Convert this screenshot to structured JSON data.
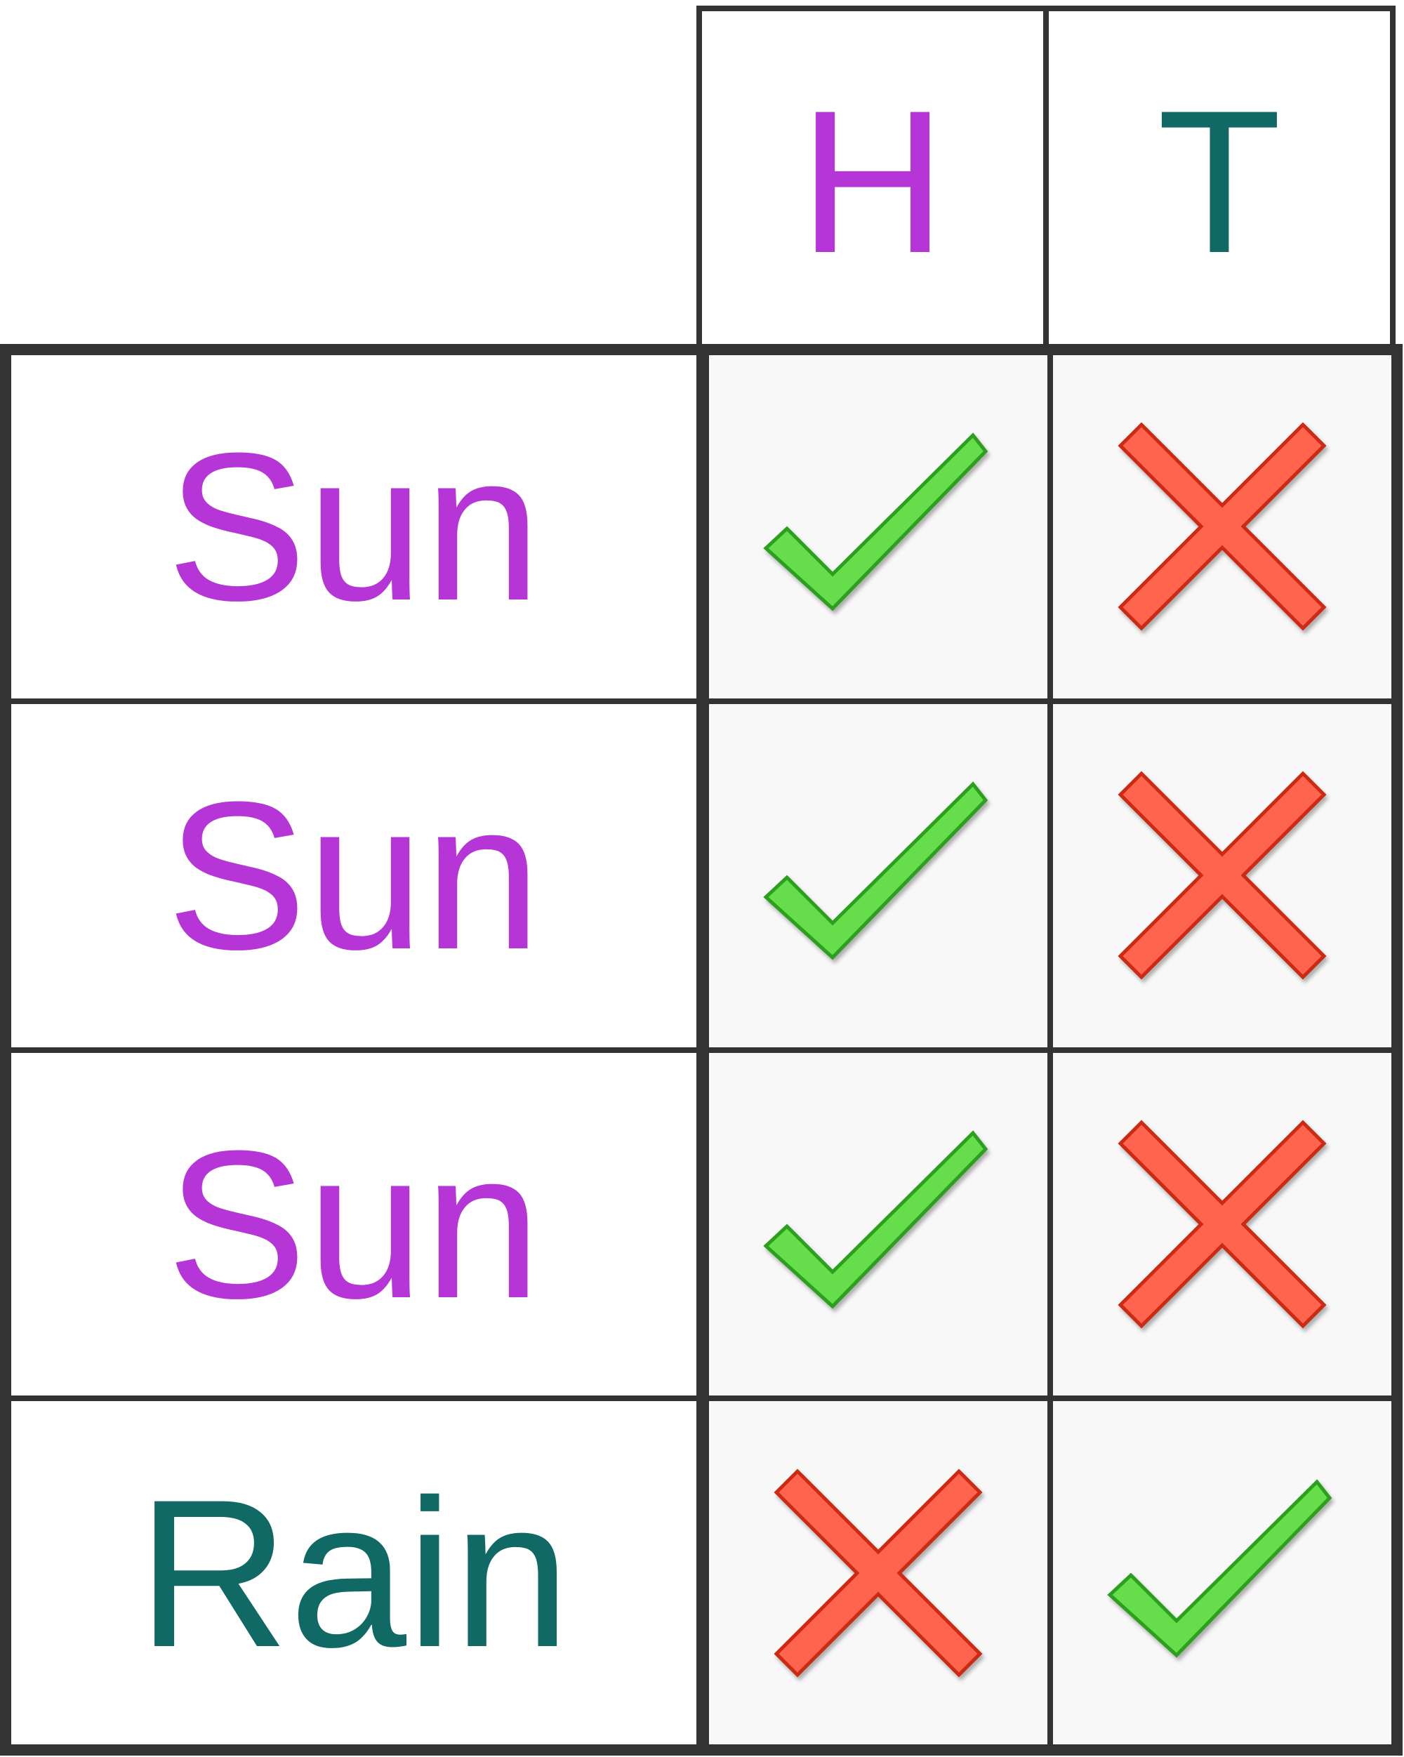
{
  "colors": {
    "sun": "#B535D6",
    "rain": "#106964",
    "check_fill": "#66DD4A",
    "check_stroke": "#2CA01E",
    "cross_fill": "#FF644E",
    "cross_stroke": "#CC2A14",
    "grid": "#333333"
  },
  "columns": [
    {
      "label": "H",
      "color_key": "sun"
    },
    {
      "label": "T",
      "color_key": "rain"
    }
  ],
  "rows": [
    {
      "label": "Sun",
      "color_key": "sun",
      "marks": [
        "check-icon",
        "cross-icon"
      ]
    },
    {
      "label": "Sun",
      "color_key": "sun",
      "marks": [
        "check-icon",
        "cross-icon"
      ]
    },
    {
      "label": "Sun",
      "color_key": "sun",
      "marks": [
        "check-icon",
        "cross-icon"
      ]
    },
    {
      "label": "Rain",
      "color_key": "rain",
      "marks": [
        "cross-icon",
        "check-icon"
      ]
    }
  ]
}
